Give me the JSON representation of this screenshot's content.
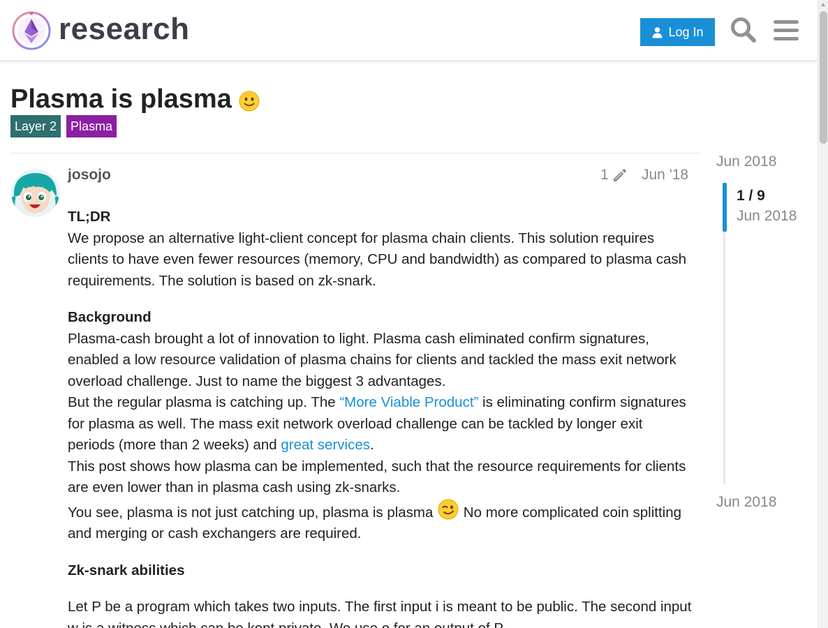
{
  "header": {
    "site_name": "research",
    "login_label": "Log In"
  },
  "topic": {
    "title": "Plasma is plasma",
    "tags": [
      "Layer 2",
      "Plasma"
    ],
    "tag_colors": [
      "#2e6f6f",
      "#8c1fa3"
    ]
  },
  "post": {
    "username": "josojo",
    "edit_count": "1",
    "date": "Jun '18",
    "tldr_heading": "TL;DR",
    "tldr_text": "We propose an alternative light-client concept for plasma chain clients. This solution requires clients to have even fewer resources (memory, CPU and bandwidth) as compared to plasma cash requirements. The solution is based on zk-snark.",
    "background_heading": "Background",
    "background_p1": "Plasma-cash brought a lot of innovation to light. Plasma cash eliminated confirm signatures, enabled a low resource validation of plasma chains for clients and tackled the mass exit network overload challenge. Just to name the biggest 3 advantages.",
    "background_p2_a": "But the regular plasma is catching up. The ",
    "link_mvp": "“More Viable Product”",
    "background_p2_b": " is eliminating confirm signatures for plasma as well. The mass exit network overload challenge can be tackled by longer exit periods (more than 2 weeks) and ",
    "link_services": "great services",
    "background_p2_c": ".",
    "background_p3": "This post shows how plasma can be implemented, such that the resource requirements for clients are even lower than in plasma cash using zk-snarks.",
    "background_p4_a": "You see, plasma is not just catching up, plasma is plasma ",
    "background_p4_b": " No more complicated coin splitting and merging or cash exchangers are required.",
    "zk_heading": "Zk-snark abilities",
    "zk_p1": "Let P be a program which takes two inputs. The first input i is meant to be public. The second input w is a witness which can be kept private. We use o for an output of P."
  },
  "timeline": {
    "start_date": "Jun 2018",
    "position": "1 / 9",
    "current_date": "Jun 2018",
    "end_date": "Jun 2018",
    "progress_fraction": 0.111
  },
  "colors": {
    "accent": "#1a8fd6",
    "text": "#222222",
    "muted": "#888888"
  },
  "icons": [
    "logo-icon",
    "user-icon",
    "search-icon",
    "hamburger-menu-icon",
    "slightly-smiling-face-icon",
    "pencil-icon",
    "wink-icon",
    "avatar-image"
  ]
}
